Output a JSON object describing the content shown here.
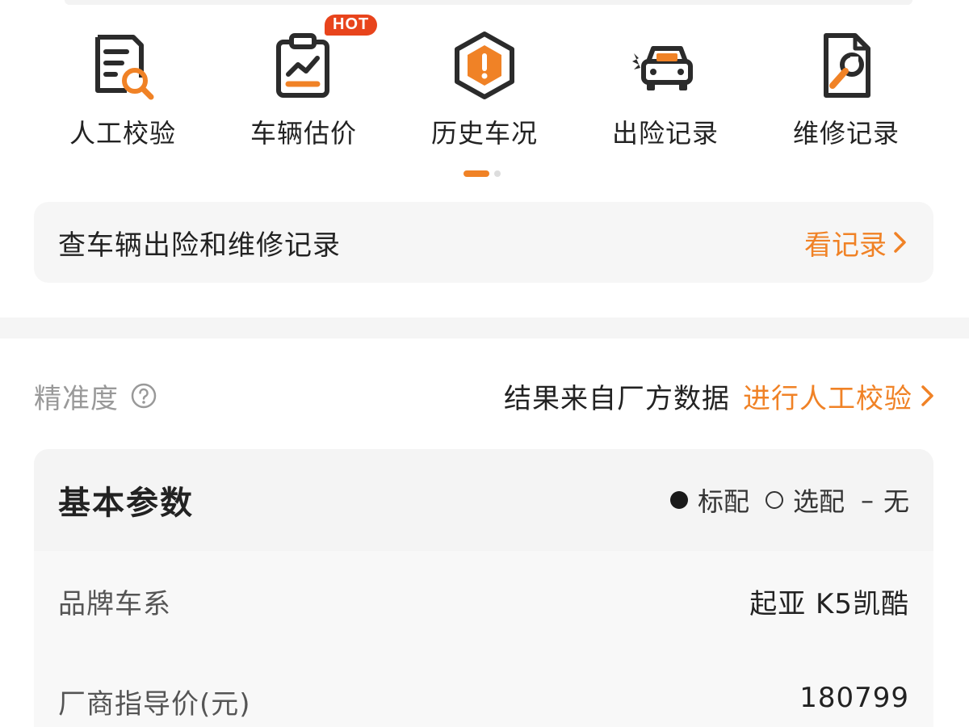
{
  "tools": [
    {
      "label": "人工校验",
      "icon": "report-search-icon"
    },
    {
      "label": "车辆估价",
      "icon": "clipboard-chart-icon",
      "badge": "HOT"
    },
    {
      "label": "历史车况",
      "icon": "hexagon-warning-icon"
    },
    {
      "label": "出险记录",
      "icon": "car-crash-icon"
    },
    {
      "label": "维修记录",
      "icon": "wrench-document-icon"
    }
  ],
  "pager": {
    "pages": 2,
    "active": 1
  },
  "record_bar": {
    "title": "查车辆出险和维修记录",
    "link": "看记录",
    "link_icon": "chevron-right-icon"
  },
  "accuracy": {
    "label": "精准度",
    "help_icon": "question-circle-icon",
    "source": "结果来自厂方数据",
    "verify_link": "进行人工校验"
  },
  "params": {
    "title": "基本参数",
    "legend": {
      "standard": "标配",
      "optional": "选配",
      "none_symbol": "–",
      "none": "无"
    },
    "rows": [
      {
        "name": "品牌车系",
        "value": "起亚 K5凯酷"
      },
      {
        "name": "厂商指导价(元)",
        "value": "180799"
      }
    ]
  },
  "colors": {
    "accent": "#f08226",
    "hot": "#e8441c",
    "icon_dark": "#2b2b2b"
  }
}
